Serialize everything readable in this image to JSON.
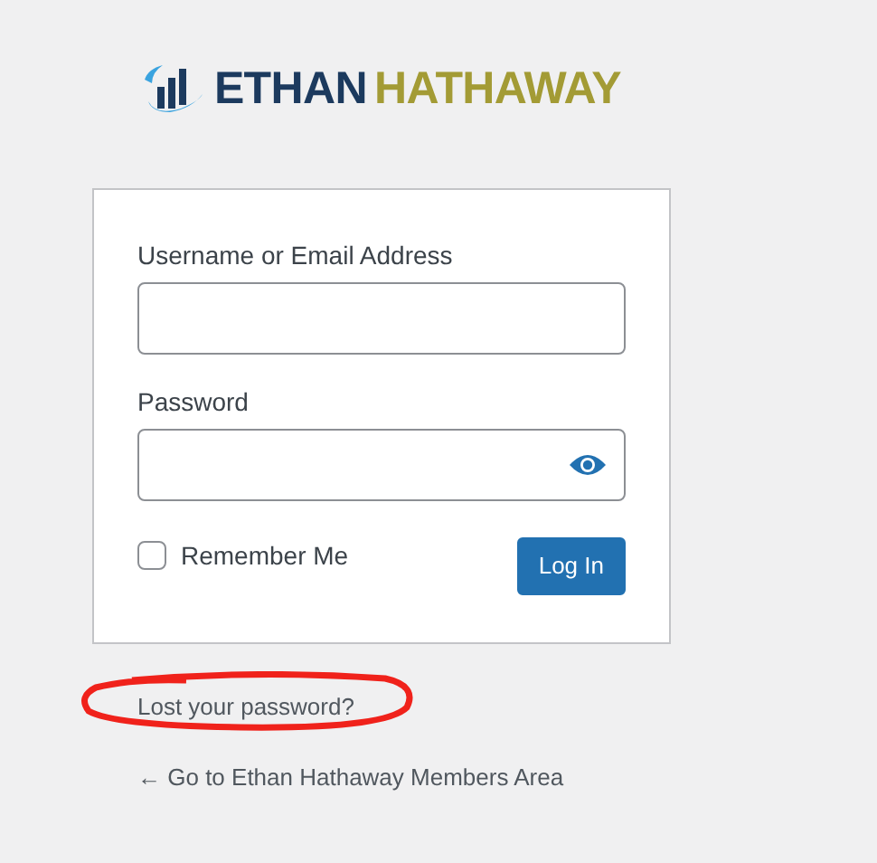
{
  "logo": {
    "first": "ETHAN",
    "second": "HATHAWAY"
  },
  "form": {
    "username_label": "Username or Email Address",
    "password_label": "Password",
    "remember": {
      "label": "Remember Me",
      "checked": false
    },
    "submit": "Log In"
  },
  "links": [
    {
      "text": "Lost your password?",
      "circled": true
    },
    {
      "text": "← Go to Ethan Hathaway Members Area",
      "circled": false
    }
  ]
}
